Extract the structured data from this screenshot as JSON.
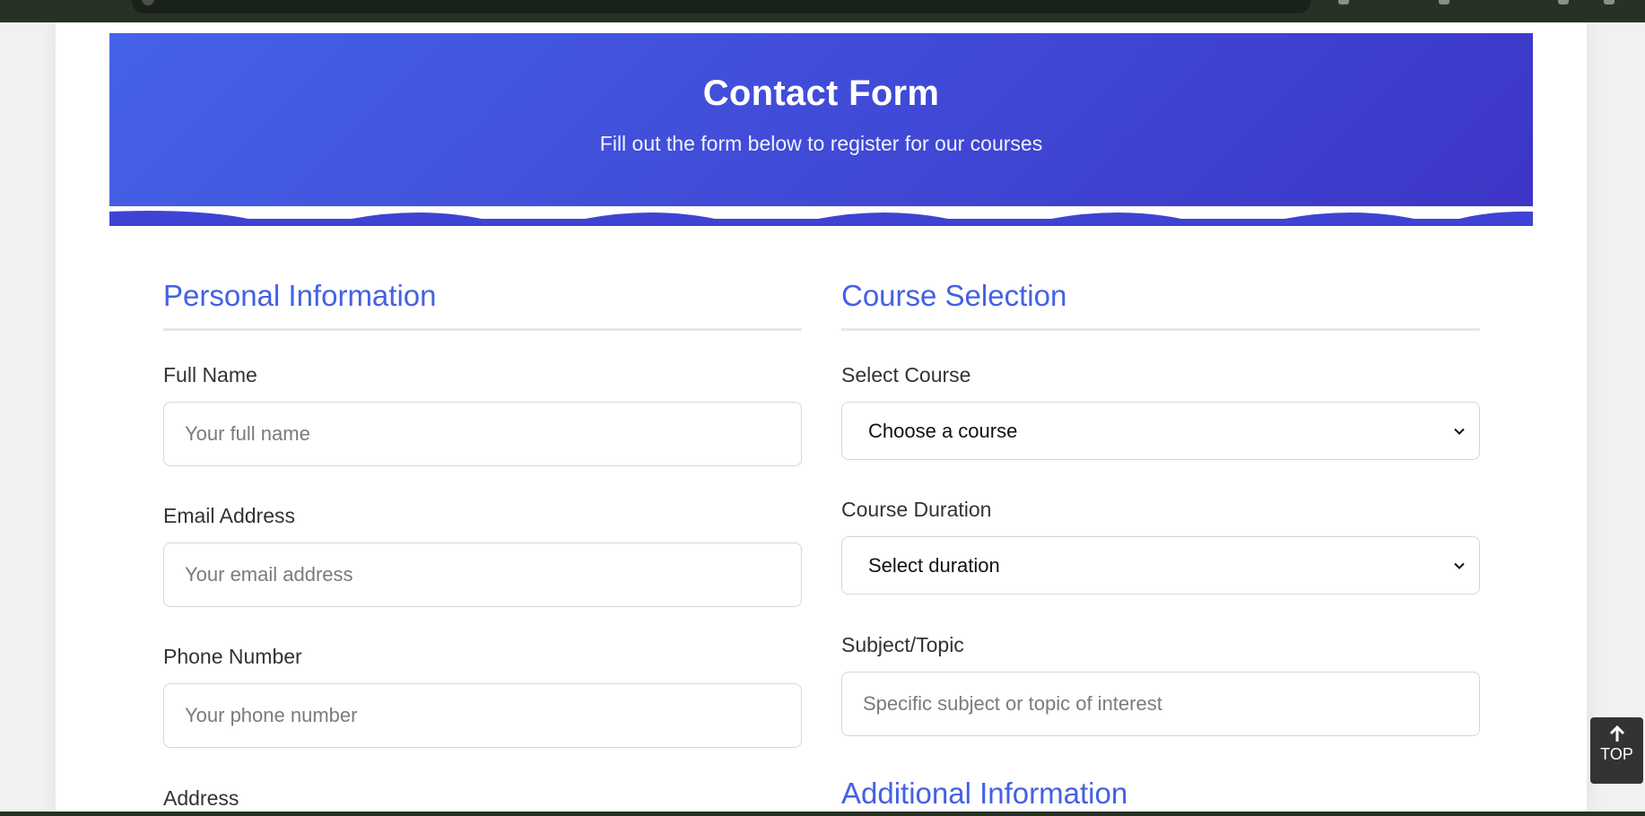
{
  "hero": {
    "title": "Contact Form",
    "subtitle": "Fill out the form below to register for our courses",
    "gradient_start": "#4462e8",
    "gradient_end": "#3d35c7"
  },
  "personal": {
    "section_title": "Personal Information",
    "full_name": {
      "label": "Full Name",
      "placeholder": "Your full name"
    },
    "email": {
      "label": "Email Address",
      "placeholder": "Your email address"
    },
    "phone": {
      "label": "Phone Number",
      "placeholder": "Your phone number"
    },
    "address": {
      "label": "Address"
    }
  },
  "course": {
    "section_title": "Course Selection",
    "select_course": {
      "label": "Select Course",
      "value": "Choose a course"
    },
    "duration": {
      "label": "Course Duration",
      "value": "Select duration"
    },
    "subject": {
      "label": "Subject/Topic",
      "placeholder": "Specific subject or topic of interest"
    }
  },
  "additional": {
    "section_title": "Additional Information"
  },
  "top_button": {
    "label": "TOP",
    "icon": "arrow-up-icon"
  },
  "colors": {
    "accent": "#4361e4",
    "button_bg": "#333333"
  }
}
